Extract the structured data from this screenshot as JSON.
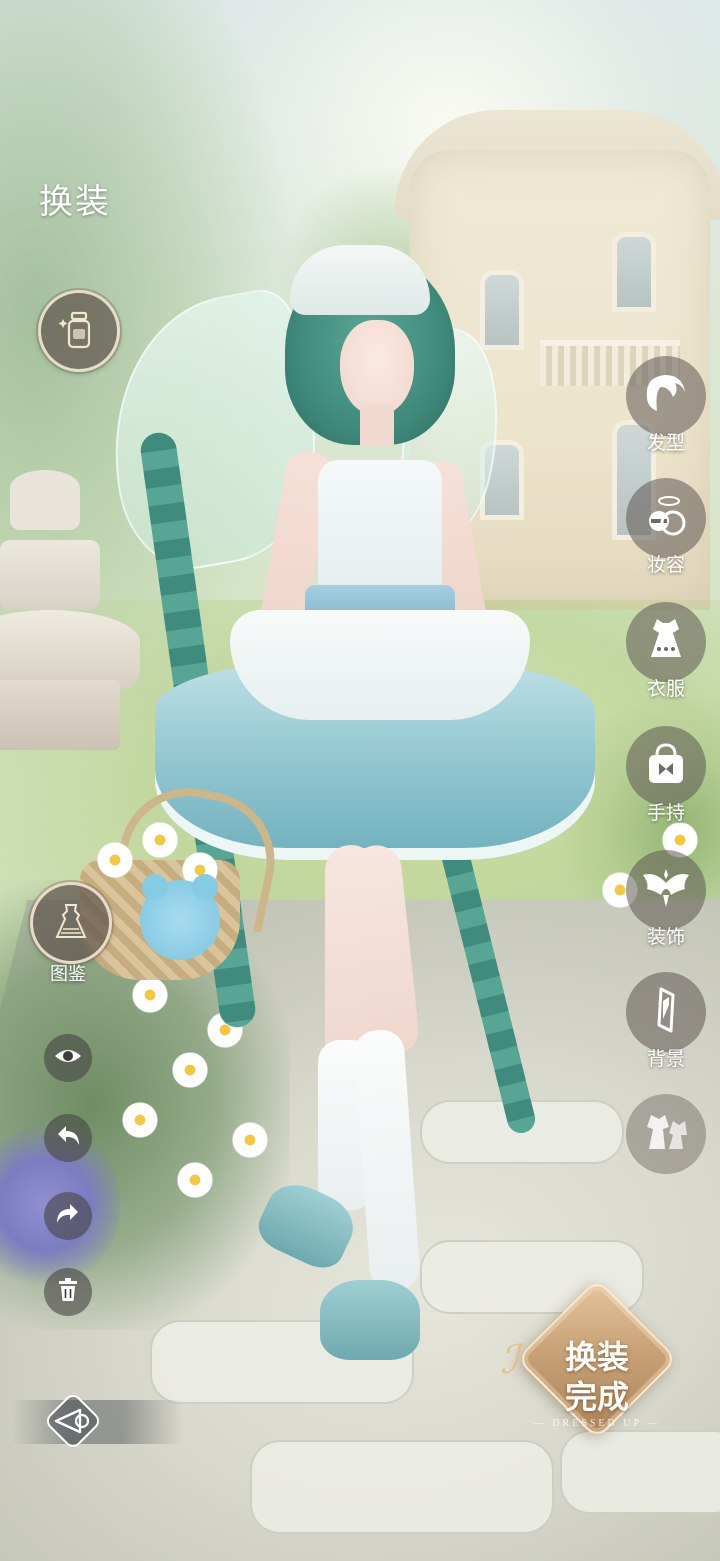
{
  "screen": {
    "title": "换装"
  },
  "left_tools": {
    "cosmetic_icon": "lotion-bottle-icon",
    "catalog_icon": "dress-icon",
    "catalog_label": "图鉴",
    "hide_ui_icon": "eye-icon",
    "undo_icon": "undo-arrow-icon",
    "redo_icon": "redo-arrow-icon",
    "delete_icon": "trash-icon",
    "back_icon": "back-arrow-icon"
  },
  "categories": [
    {
      "label": "发型",
      "icon": "hair-icon"
    },
    {
      "label": "妆容",
      "icon": "makeup-icon"
    },
    {
      "label": "衣服",
      "icon": "dress-icon"
    },
    {
      "label": "手持",
      "icon": "handbag-icon"
    },
    {
      "label": "装饰",
      "icon": "wings-icon"
    },
    {
      "label": "背景",
      "icon": "background-icon"
    },
    {
      "label": "",
      "icon": "outfit-set-icon"
    }
  ],
  "finish_button": {
    "line1": "换装",
    "line2": "完成",
    "subtitle": "— DRESSED UP —"
  },
  "colors": {
    "button_rim": "#eee2cd",
    "finish_gold": "#c8a176",
    "label_text": "#ffffff"
  }
}
